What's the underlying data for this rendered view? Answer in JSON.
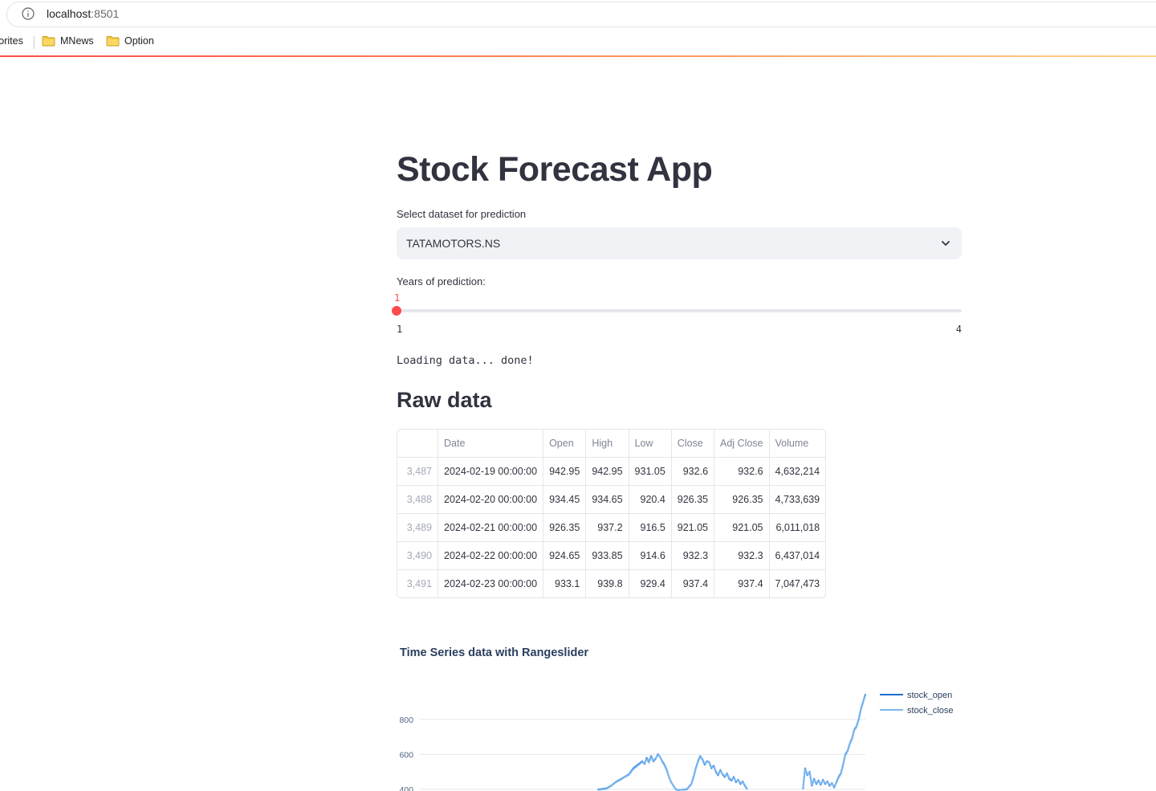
{
  "browser": {
    "url_host": "localhost",
    "url_port": ":8501",
    "bookmarks": [
      {
        "label": "vorites"
      },
      {
        "label": "MNews"
      },
      {
        "label": "Option"
      }
    ]
  },
  "app": {
    "title": "Stock Forecast App",
    "dataset_label": "Select dataset for prediction",
    "dataset_value": "TATAMOTORS.NS",
    "years_label": "Years of prediction:",
    "years_value": "1",
    "years_min": "1",
    "years_max": "4",
    "years_fraction": 0,
    "status": "Loading data... done!",
    "raw_data_heading": "Raw data"
  },
  "table": {
    "columns": [
      "",
      "Date",
      "Open",
      "High",
      "Low",
      "Close",
      "Adj Close",
      "Volume"
    ],
    "rows": [
      [
        "3,487",
        "2024-02-19 00:00:00",
        "942.95",
        "942.95",
        "931.05",
        "932.6",
        "932.6",
        "4,632,214"
      ],
      [
        "3,488",
        "2024-02-20 00:00:00",
        "934.45",
        "934.65",
        "920.4",
        "926.35",
        "926.35",
        "4,733,639"
      ],
      [
        "3,489",
        "2024-02-21 00:00:00",
        "926.35",
        "937.2",
        "916.5",
        "921.05",
        "921.05",
        "6,011,018"
      ],
      [
        "3,490",
        "2024-02-22 00:00:00",
        "924.65",
        "933.85",
        "914.6",
        "932.3",
        "932.3",
        "6,437,014"
      ],
      [
        "3,491",
        "2024-02-23 00:00:00",
        "933.1",
        "939.8",
        "929.4",
        "937.4",
        "937.4",
        "7,047,473"
      ]
    ]
  },
  "chart_data": {
    "type": "line",
    "title": "Time Series data with Rangeslider",
    "xlabel": "",
    "ylabel": "",
    "yticks": [
      400,
      600,
      800
    ],
    "ytick_labels": [
      "400",
      "600",
      "800"
    ],
    "ylim": [
      390,
      960
    ],
    "grid": true,
    "legend_position": "top-right",
    "series": [
      {
        "name": "stock_open",
        "color": "#1f6fd1",
        "values": [
          [
            0.4,
            398
          ],
          [
            0.42,
            405
          ],
          [
            0.43,
            420
          ],
          [
            0.44,
            440
          ],
          [
            0.45,
            455
          ],
          [
            0.46,
            470
          ],
          [
            0.47,
            485
          ],
          [
            0.48,
            520
          ],
          [
            0.49,
            540
          ],
          [
            0.5,
            560
          ],
          [
            0.505,
            545
          ],
          [
            0.51,
            580
          ],
          [
            0.515,
            555
          ],
          [
            0.52,
            590
          ],
          [
            0.525,
            560
          ],
          [
            0.53,
            575
          ],
          [
            0.535,
            600
          ],
          [
            0.54,
            585
          ],
          [
            0.545,
            560
          ],
          [
            0.55,
            540
          ],
          [
            0.555,
            510
          ],
          [
            0.56,
            470
          ],
          [
            0.565,
            440
          ],
          [
            0.57,
            420
          ],
          [
            0.575,
            400
          ],
          [
            0.58,
            395
          ],
          [
            0.6,
            400
          ],
          [
            0.61,
            430
          ],
          [
            0.615,
            470
          ],
          [
            0.62,
            520
          ],
          [
            0.625,
            560
          ],
          [
            0.63,
            590
          ],
          [
            0.635,
            570
          ],
          [
            0.64,
            540
          ],
          [
            0.645,
            560
          ],
          [
            0.65,
            555
          ],
          [
            0.655,
            520
          ],
          [
            0.66,
            535
          ],
          [
            0.665,
            500
          ],
          [
            0.67,
            480
          ],
          [
            0.675,
            510
          ],
          [
            0.68,
            485
          ],
          [
            0.685,
            470
          ],
          [
            0.69,
            490
          ],
          [
            0.695,
            460
          ],
          [
            0.7,
            450
          ],
          [
            0.705,
            470
          ],
          [
            0.71,
            440
          ],
          [
            0.715,
            455
          ],
          [
            0.72,
            430
          ],
          [
            0.725,
            445
          ],
          [
            0.73,
            420
          ],
          [
            0.735,
            400
          ],
          [
            0.86,
            400
          ],
          [
            0.865,
            520
          ],
          [
            0.87,
            480
          ],
          [
            0.875,
            500
          ],
          [
            0.88,
            420
          ],
          [
            0.885,
            460
          ],
          [
            0.89,
            430
          ],
          [
            0.895,
            450
          ],
          [
            0.9,
            425
          ],
          [
            0.905,
            455
          ],
          [
            0.91,
            430
          ],
          [
            0.915,
            445
          ],
          [
            0.92,
            420
          ],
          [
            0.925,
            435
          ],
          [
            0.93,
            410
          ],
          [
            0.935,
            440
          ],
          [
            0.94,
            470
          ],
          [
            0.945,
            490
          ],
          [
            0.95,
            540
          ],
          [
            0.955,
            600
          ],
          [
            0.96,
            620
          ],
          [
            0.965,
            660
          ],
          [
            0.97,
            690
          ],
          [
            0.975,
            740
          ],
          [
            0.98,
            760
          ],
          [
            0.985,
            800
          ],
          [
            0.99,
            860
          ],
          [
            0.995,
            900
          ],
          [
            1.0,
            945
          ]
        ]
      },
      {
        "name": "stock_close",
        "color": "#7ab8f0",
        "values": [
          [
            0.4,
            396
          ],
          [
            0.42,
            402
          ],
          [
            0.43,
            418
          ],
          [
            0.44,
            438
          ],
          [
            0.45,
            452
          ],
          [
            0.46,
            468
          ],
          [
            0.47,
            482
          ],
          [
            0.48,
            515
          ],
          [
            0.49,
            535
          ],
          [
            0.5,
            556
          ],
          [
            0.505,
            548
          ],
          [
            0.51,
            575
          ],
          [
            0.515,
            552
          ],
          [
            0.52,
            585
          ],
          [
            0.525,
            564
          ],
          [
            0.53,
            578
          ],
          [
            0.535,
            596
          ],
          [
            0.54,
            588
          ],
          [
            0.545,
            556
          ],
          [
            0.55,
            536
          ],
          [
            0.555,
            506
          ],
          [
            0.56,
            468
          ],
          [
            0.565,
            442
          ],
          [
            0.57,
            418
          ],
          [
            0.575,
            402
          ],
          [
            0.58,
            396
          ],
          [
            0.6,
            398
          ],
          [
            0.61,
            428
          ],
          [
            0.615,
            466
          ],
          [
            0.62,
            516
          ],
          [
            0.625,
            556
          ],
          [
            0.63,
            586
          ],
          [
            0.635,
            574
          ],
          [
            0.64,
            544
          ],
          [
            0.645,
            556
          ],
          [
            0.65,
            558
          ],
          [
            0.655,
            524
          ],
          [
            0.66,
            530
          ],
          [
            0.665,
            504
          ],
          [
            0.67,
            484
          ],
          [
            0.675,
            506
          ],
          [
            0.68,
            488
          ],
          [
            0.685,
            474
          ],
          [
            0.69,
            486
          ],
          [
            0.695,
            464
          ],
          [
            0.7,
            454
          ],
          [
            0.705,
            466
          ],
          [
            0.71,
            444
          ],
          [
            0.715,
            452
          ],
          [
            0.72,
            434
          ],
          [
            0.725,
            442
          ],
          [
            0.73,
            424
          ],
          [
            0.735,
            402
          ],
          [
            0.86,
            402
          ],
          [
            0.865,
            516
          ],
          [
            0.87,
            484
          ],
          [
            0.875,
            496
          ],
          [
            0.88,
            424
          ],
          [
            0.885,
            456
          ],
          [
            0.89,
            434
          ],
          [
            0.895,
            446
          ],
          [
            0.9,
            428
          ],
          [
            0.905,
            452
          ],
          [
            0.91,
            434
          ],
          [
            0.915,
            442
          ],
          [
            0.92,
            424
          ],
          [
            0.925,
            432
          ],
          [
            0.93,
            414
          ],
          [
            0.935,
            436
          ],
          [
            0.94,
            466
          ],
          [
            0.945,
            486
          ],
          [
            0.95,
            536
          ],
          [
            0.955,
            596
          ],
          [
            0.96,
            616
          ],
          [
            0.965,
            656
          ],
          [
            0.97,
            686
          ],
          [
            0.975,
            736
          ],
          [
            0.98,
            756
          ],
          [
            0.985,
            796
          ],
          [
            0.99,
            856
          ],
          [
            0.995,
            896
          ],
          [
            1.0,
            940
          ]
        ]
      }
    ]
  }
}
